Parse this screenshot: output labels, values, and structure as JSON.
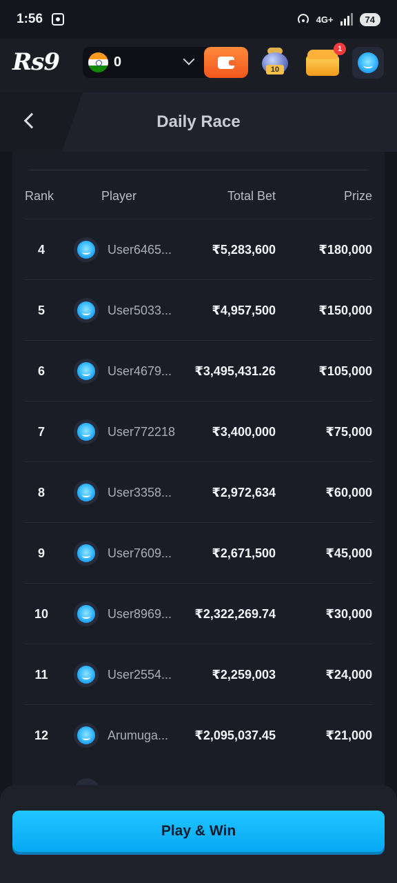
{
  "status_bar": {
    "time": "1:56",
    "network": "4G+",
    "battery": "74"
  },
  "top_bar": {
    "logo": "Rs9",
    "balance": "0",
    "pot_badge": "10",
    "chest_badge": "1"
  },
  "header": {
    "title": "Daily Race"
  },
  "table": {
    "columns": [
      "Rank",
      "Player",
      "Total Bet",
      "Prize"
    ],
    "rows": [
      {
        "rank": "4",
        "player": "User6465...",
        "bet": "₹5,283,600",
        "prize": "₹180,000"
      },
      {
        "rank": "5",
        "player": "User5033...",
        "bet": "₹4,957,500",
        "prize": "₹150,000"
      },
      {
        "rank": "6",
        "player": "User4679...",
        "bet": "₹3,495,431.26",
        "prize": "₹105,000"
      },
      {
        "rank": "7",
        "player": "User772218",
        "bet": "₹3,400,000",
        "prize": "₹75,000"
      },
      {
        "rank": "8",
        "player": "User3358...",
        "bet": "₹2,972,634",
        "prize": "₹60,000"
      },
      {
        "rank": "9",
        "player": "User7609...",
        "bet": "₹2,671,500",
        "prize": "₹45,000"
      },
      {
        "rank": "10",
        "player": "User8969...",
        "bet": "₹2,322,269.74",
        "prize": "₹30,000"
      },
      {
        "rank": "11",
        "player": "User2554...",
        "bet": "₹2,259,003",
        "prize": "₹24,000"
      },
      {
        "rank": "12",
        "player": "Arumuga...",
        "bet": "₹2,095,037.45",
        "prize": "₹21,000"
      }
    ]
  },
  "bottom": {
    "play_label": "Play & Win"
  },
  "colors": {
    "accent": "#08a8f4",
    "wallet": "#f2561c",
    "background": "#14161d"
  }
}
